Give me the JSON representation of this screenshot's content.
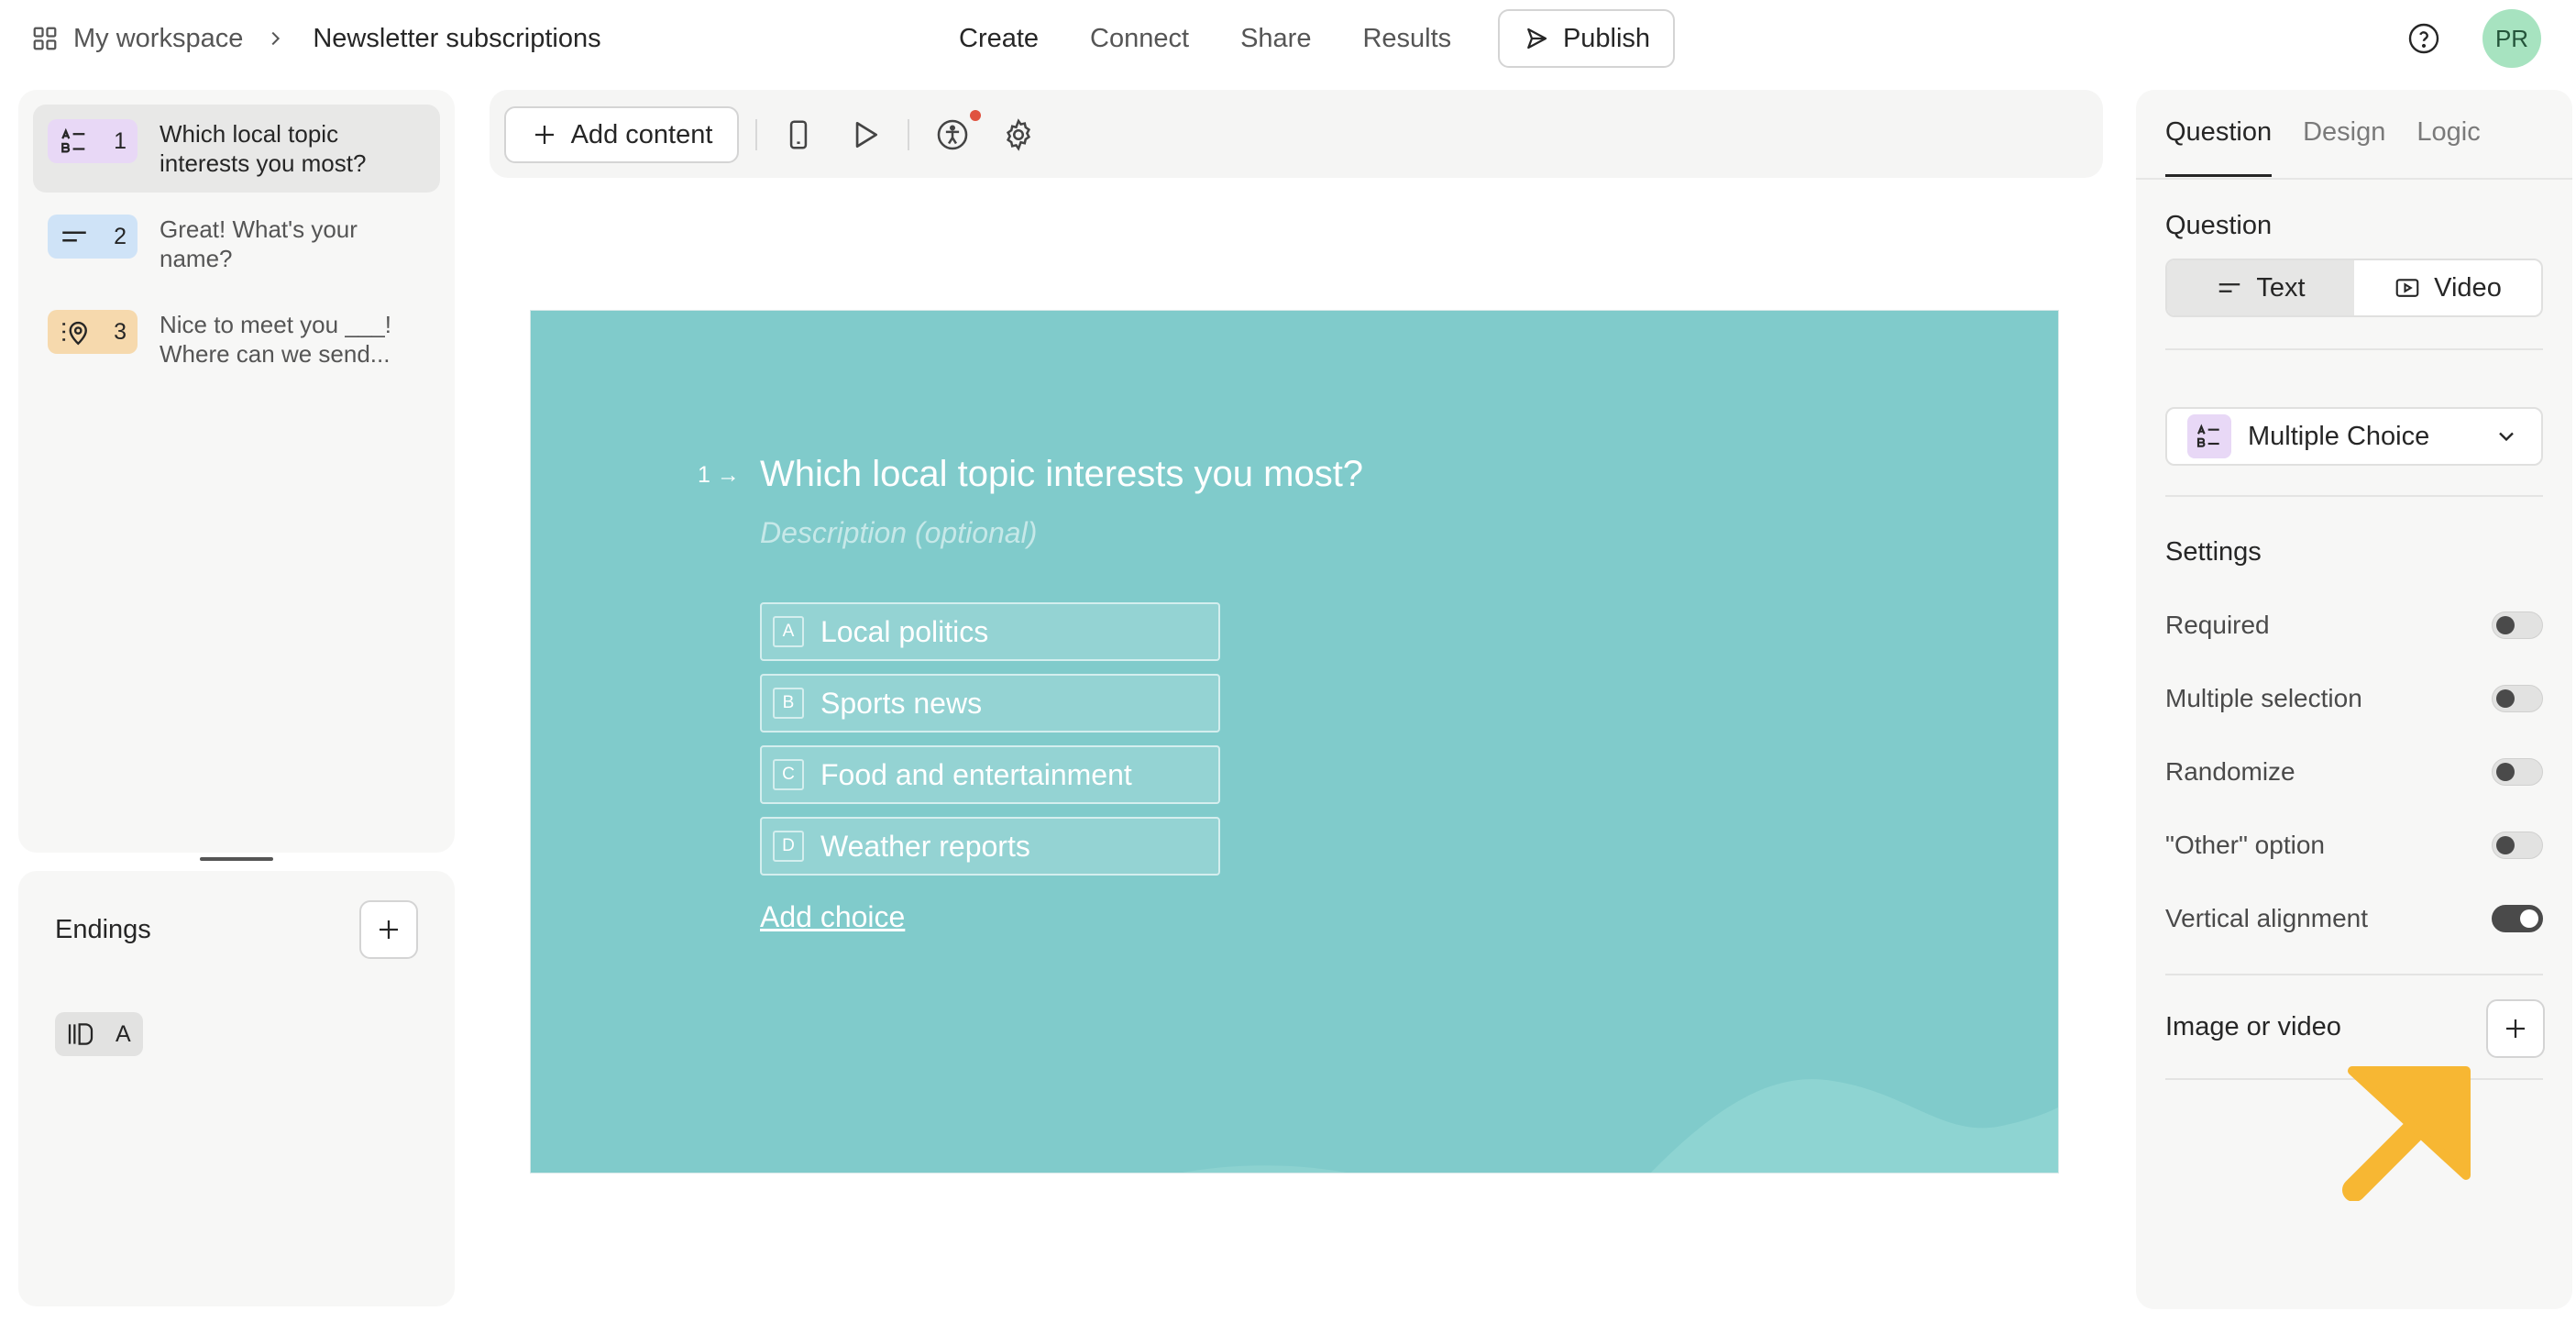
{
  "breadcrumb": {
    "workspace": "My workspace",
    "page": "Newsletter subscriptions"
  },
  "nav": {
    "create": "Create",
    "connect": "Connect",
    "share": "Share",
    "results": "Results",
    "publish": "Publish"
  },
  "user": {
    "initials": "PR"
  },
  "questions": [
    {
      "number": "1",
      "title": "Which local topic interests you most?",
      "icon": "multiple-choice-icon",
      "color": "#e8d8f6"
    },
    {
      "number": "2",
      "title": "Great! What's your name?",
      "icon": "short-text-icon",
      "color": "#cfe3f7"
    },
    {
      "number": "3",
      "title": "Nice to meet you ___! Where can we send...",
      "icon": "address-icon",
      "color": "#f6d9ad"
    }
  ],
  "endings": {
    "title": "Endings",
    "items": [
      {
        "label": "A",
        "icon": "ending-icon"
      }
    ]
  },
  "toolbar": {
    "add_content": "Add content"
  },
  "canvas": {
    "background": "#80cbcb",
    "question_number": "1",
    "question_title": "Which local topic interests you most?",
    "description_placeholder": "Description (optional)",
    "choices": [
      {
        "key": "A",
        "label": "Local politics"
      },
      {
        "key": "B",
        "label": "Sports news"
      },
      {
        "key": "C",
        "label": "Food and entertainment"
      },
      {
        "key": "D",
        "label": "Weather reports"
      }
    ],
    "add_choice": "Add choice"
  },
  "panel": {
    "tabs": [
      "Question",
      "Design",
      "Logic"
    ],
    "question_section": "Question",
    "media_types": [
      "Text",
      "Video"
    ],
    "question_type": "Multiple Choice",
    "settings_title": "Settings",
    "settings": [
      {
        "label": "Required",
        "on": false
      },
      {
        "label": "Multiple selection",
        "on": false
      },
      {
        "label": "Randomize",
        "on": false
      },
      {
        "label": "\"Other\" option",
        "on": false
      },
      {
        "label": "Vertical alignment",
        "on": true
      }
    ],
    "image_or_video": "Image or video"
  },
  "colors": {
    "accent_arrow": "#f7b733",
    "avatar": "#a7e3c0"
  }
}
